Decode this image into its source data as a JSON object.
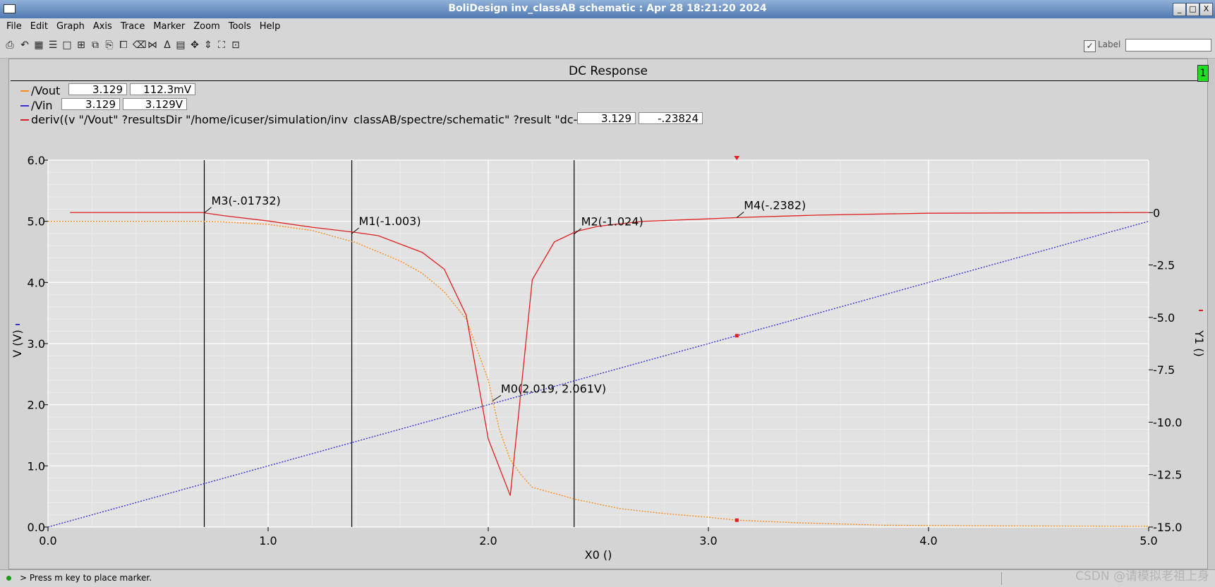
{
  "window": {
    "title": "BoliDesign inv_classAB schematic : Apr 28 18:21:20 2024",
    "minimize": "_",
    "maximize": "□",
    "close": "X"
  },
  "menu": [
    "File",
    "Edit",
    "Graph",
    "Axis",
    "Trace",
    "Marker",
    "Zoom",
    "Tools",
    "Help"
  ],
  "toolbar": {
    "tools": [
      "print-icon",
      "undo-icon",
      "grid-icon",
      "strips-icon",
      "blank-icon",
      "zoom-in-icon",
      "zoom-out-icon",
      "copy-icon",
      "paste-icon",
      "delete-icon",
      "marker-icon",
      "delta-marker-icon",
      "fit-icon",
      "pan-x-icon",
      "pan-y-icon",
      "fit-all-icon"
    ],
    "label_check": "✓",
    "label_text": "Label",
    "label_value": ""
  },
  "plot": {
    "title": "DC Response",
    "subwindow": "1",
    "legend": [
      {
        "name": "/Vout",
        "color": "#ff8c1a",
        "x_value": "3.129",
        "y_value": "112.3mV"
      },
      {
        "name": "/Vin",
        "color": "#3434d6",
        "x_value": "3.129",
        "y_value": "3.129V"
      },
      {
        "name": "deriv((v \"/Vout\" ?resultsDir \"/home/icuser/simulation/inv_classAB/spectre/schematic\" ?result \"dc-d",
        "color": "#e02020",
        "x_value": "3.129",
        "y_value": "-.23824"
      }
    ]
  },
  "status": {
    "message": "> Press m key to place marker."
  },
  "watermark": "CSDN @请模拟老祖上身",
  "chart_data": {
    "type": "line",
    "title": "DC Response",
    "xlabel": "X0 ()",
    "ylabel": "V (V)",
    "y2label": "Y1 ()",
    "xlim": [
      0.0,
      5.0
    ],
    "ylim": [
      0.0,
      6.0
    ],
    "y2lim": [
      -15.0,
      2.5
    ],
    "x_ticks": [
      "0.0",
      "1.0",
      "2.0",
      "3.0",
      "4.0",
      "5.0"
    ],
    "y_ticks": [
      "0.0",
      "1.0",
      "2.0",
      "3.0",
      "4.0",
      "5.0",
      "6.0"
    ],
    "y2_ticks": [
      "-15.0",
      "-12.5",
      "-10.0",
      "-7.5",
      "-5.0",
      "-2.5",
      "0"
    ],
    "grid": true,
    "series": [
      {
        "name": "/Vout",
        "axis": "left",
        "color": "#ff8c1a",
        "style": "dotted",
        "x": [
          0.0,
          0.7,
          0.8,
          1.0,
          1.2,
          1.4,
          1.6,
          1.7,
          1.8,
          1.9,
          2.0,
          2.05,
          2.1,
          2.15,
          2.2,
          2.4,
          2.6,
          2.8,
          3.0,
          3.129,
          3.4,
          3.8,
          4.2,
          5.0
        ],
        "y": [
          5.0,
          5.0,
          4.99,
          4.95,
          4.85,
          4.65,
          4.35,
          4.15,
          3.85,
          3.4,
          2.4,
          1.6,
          1.1,
          0.85,
          0.65,
          0.45,
          0.3,
          0.22,
          0.16,
          0.112,
          0.07,
          0.03,
          0.02,
          0.01
        ]
      },
      {
        "name": "/Vin",
        "axis": "left",
        "color": "#3434d6",
        "style": "dotted",
        "x": [
          0.0,
          5.0
        ],
        "y": [
          0.0,
          5.0
        ]
      },
      {
        "name": "deriv((v \"/Vout\" ?resultsDir \"/home/icuser/simulation/inv_classAB/spectre/schematic\" ?result \"dc-d",
        "axis": "right",
        "color": "#e02020",
        "style": "solid",
        "x": [
          0.1,
          0.7,
          0.8,
          1.0,
          1.2,
          1.4,
          1.5,
          1.6,
          1.7,
          1.8,
          1.9,
          2.0,
          2.1,
          2.2,
          2.3,
          2.4,
          2.5,
          2.7,
          3.0,
          3.129,
          3.5,
          4.0,
          5.0
        ],
        "y": [
          0.0,
          0.0,
          -0.15,
          -0.4,
          -0.7,
          -0.95,
          -1.1,
          -1.5,
          -1.9,
          -2.7,
          -4.9,
          -10.8,
          -13.5,
          -3.2,
          -1.4,
          -0.9,
          -0.65,
          -0.42,
          -0.3,
          -0.238,
          -0.12,
          -0.03,
          0.0
        ]
      }
    ],
    "markers": [
      {
        "label": "M3(-.01732)",
        "x": 0.71,
        "y2": -0.017,
        "vertical": true
      },
      {
        "label": "M1(-1.003)",
        "x": 1.38,
        "y2": -1.003,
        "vertical": true
      },
      {
        "label": "M2(-1.024)",
        "x": 2.39,
        "y2": -1.024,
        "vertical": true
      },
      {
        "label": "M4(-.2382)",
        "x": 3.129,
        "y2": -0.238,
        "vertical": false
      },
      {
        "label": "M0(2.019, 2.061V)",
        "x": 2.019,
        "y": 2.061,
        "vertical": false
      }
    ],
    "cursor_x": 3.129
  }
}
